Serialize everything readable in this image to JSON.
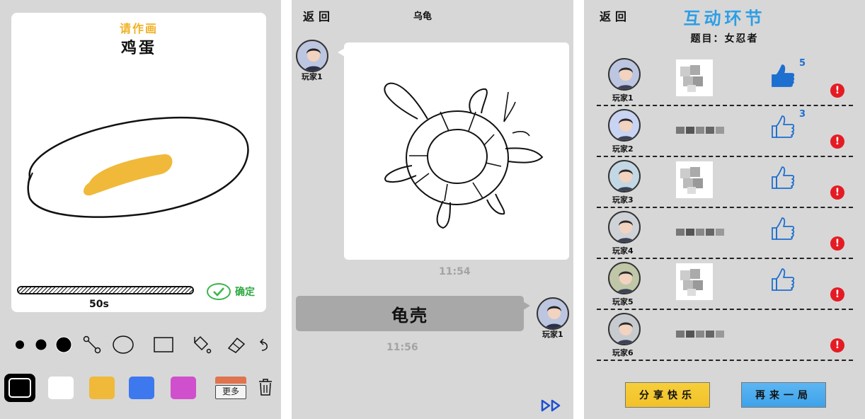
{
  "draw_screen": {
    "prompt_label": "请作画",
    "word": "鸡蛋",
    "timer": {
      "remaining": "50s",
      "progress": 1.0
    },
    "confirm_label": "确定",
    "tools": [
      "brush-small-icon",
      "brush-medium-icon",
      "brush-large-icon",
      "line-tool-icon",
      "ellipse-tool-icon",
      "rectangle-tool-icon",
      "fill-bucket-icon",
      "eraser-icon",
      "undo-icon"
    ],
    "colors": [
      {
        "hex": "#000000",
        "selected": true
      },
      {
        "hex": "#ffffff",
        "selected": false
      },
      {
        "hex": "#f0b93a",
        "selected": false
      },
      {
        "hex": "#3d78ef",
        "selected": false
      },
      {
        "hex": "#d04fcd",
        "selected": false
      }
    ],
    "more_label": "更多"
  },
  "chat_screen": {
    "back_label": "返回",
    "title": "乌龟",
    "messages": [
      {
        "player": "玩家1",
        "type": "drawing",
        "time": "11:54"
      },
      {
        "player": "玩家1",
        "type": "text",
        "text": "龟壳",
        "time": "11:56"
      }
    ]
  },
  "result_screen": {
    "back_label": "返回",
    "title": "互动环节",
    "topic": "题目：女忍者",
    "players": [
      {
        "name": "玩家1",
        "entry": "image",
        "likes": "5",
        "liked": true
      },
      {
        "name": "玩家2",
        "entry": "text",
        "likes": "3",
        "liked": false
      },
      {
        "name": "玩家3",
        "entry": "image",
        "likes": "",
        "liked": false
      },
      {
        "name": "玩家4",
        "entry": "text",
        "likes": "",
        "liked": false
      },
      {
        "name": "玩家5",
        "entry": "image",
        "likes": "",
        "liked": false
      },
      {
        "name": "玩家6",
        "entry": "text",
        "likes": null,
        "liked": null
      }
    ],
    "report_symbol": "!",
    "share_label": "分享快乐",
    "again_label": "再来一局"
  },
  "colors": {
    "accent_blue": "#2d9ee6",
    "confirm_green": "#3bb54a",
    "prompt_yellow": "#f0b226",
    "report_red": "#e51b24"
  }
}
